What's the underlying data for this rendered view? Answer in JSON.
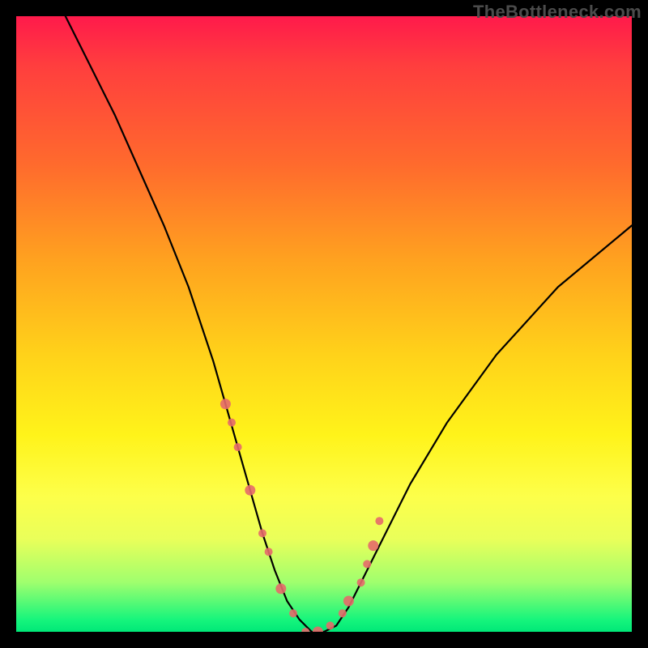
{
  "watermark": "TheBottleneck.com",
  "chart_data": {
    "type": "line",
    "title": "",
    "xlabel": "",
    "ylabel": "",
    "ylim": [
      0,
      100
    ],
    "xlim": [
      0,
      100
    ],
    "series": [
      {
        "name": "curve",
        "x": [
          8,
          12,
          16,
          20,
          24,
          28,
          32,
          34,
          36,
          38,
          40,
          42,
          44,
          46,
          48,
          50,
          52,
          54,
          56,
          60,
          64,
          70,
          78,
          88,
          100
        ],
        "y": [
          100,
          92,
          84,
          75,
          66,
          56,
          44,
          37,
          30,
          23,
          16,
          10,
          5,
          2,
          0,
          0,
          1,
          4,
          8,
          16,
          24,
          34,
          45,
          56,
          66
        ]
      }
    ],
    "markers": {
      "name": "highlight-points",
      "x": [
        34,
        35,
        36,
        38,
        40,
        41,
        43,
        45,
        47,
        49,
        51,
        53,
        54,
        56,
        57,
        58,
        59
      ],
      "y": [
        37,
        34,
        30,
        23,
        16,
        13,
        7,
        3,
        0,
        0,
        1,
        3,
        5,
        8,
        11,
        14,
        18
      ]
    },
    "gradient_stops": [
      {
        "pos": 0,
        "color": "#ff1a4b"
      },
      {
        "pos": 24,
        "color": "#ff6a2d"
      },
      {
        "pos": 55,
        "color": "#ffd21a"
      },
      {
        "pos": 78,
        "color": "#fdff4a"
      },
      {
        "pos": 100,
        "color": "#00e878"
      }
    ]
  }
}
